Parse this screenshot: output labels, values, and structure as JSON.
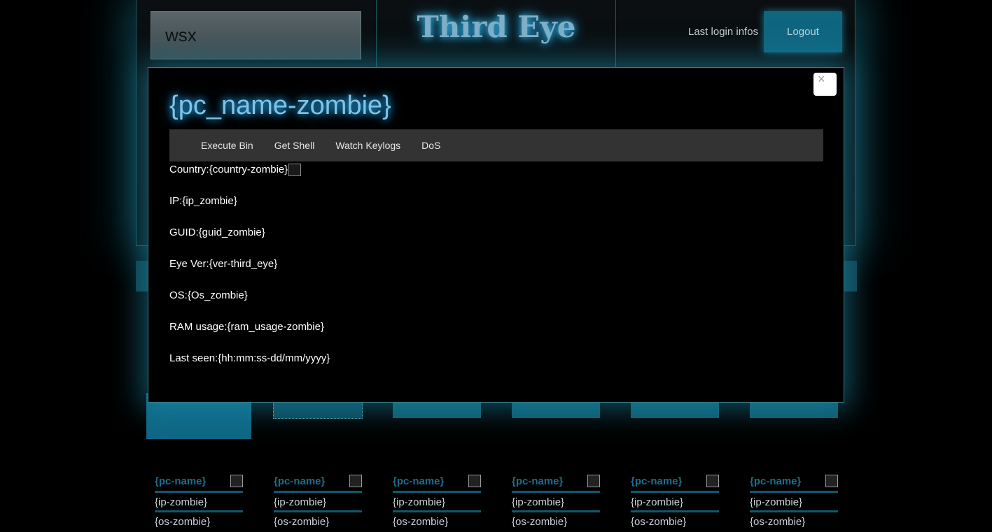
{
  "header": {
    "search_value": "wsx",
    "app_title": "Third Eye",
    "last_login_label": "Last login infos",
    "logout_label": "Logout"
  },
  "modal": {
    "close_symbol": "×",
    "title": "{pc_name-zombie}",
    "menu": [
      "Execute Bin",
      "Get Shell",
      "Watch Keylogs",
      "DoS"
    ],
    "details": [
      {
        "label": "Country:",
        "value": "{country-zombie}"
      },
      {
        "label": "IP:",
        "value": "{ip_zombie}"
      },
      {
        "label": "GUID:",
        "value": "{guid_zombie}"
      },
      {
        "label": "Eye Ver:",
        "value": "{ver-third_eye}"
      },
      {
        "label": "OS:",
        "value": "{Os_zombie}"
      },
      {
        "label": "RAM usage:",
        "value": "{ram_usage-zombie}"
      },
      {
        "label": "Last seen:",
        "value": "{hh:mm:ss-dd/mm/yyyy}"
      }
    ]
  },
  "zombies": [
    {
      "name": "{pc-name}",
      "ip": "{ip-zombie}",
      "os": "{os-zombie}"
    },
    {
      "name": "{pc-name}",
      "ip": "{ip-zombie}",
      "os": "{os-zombie}"
    },
    {
      "name": "{pc-name}",
      "ip": "{ip-zombie}",
      "os": "{os-zombie}"
    },
    {
      "name": "{pc-name}",
      "ip": "{ip-zombie}",
      "os": "{os-zombie}"
    },
    {
      "name": "{pc-name}",
      "ip": "{ip-zombie}",
      "os": "{os-zombie}"
    },
    {
      "name": "{pc-name}",
      "ip": "{ip-zombie}",
      "os": "{os-zombie}"
    }
  ],
  "colors": {
    "accent": "#0f6680",
    "glow": "#2fb4ff",
    "background": "#000000"
  }
}
